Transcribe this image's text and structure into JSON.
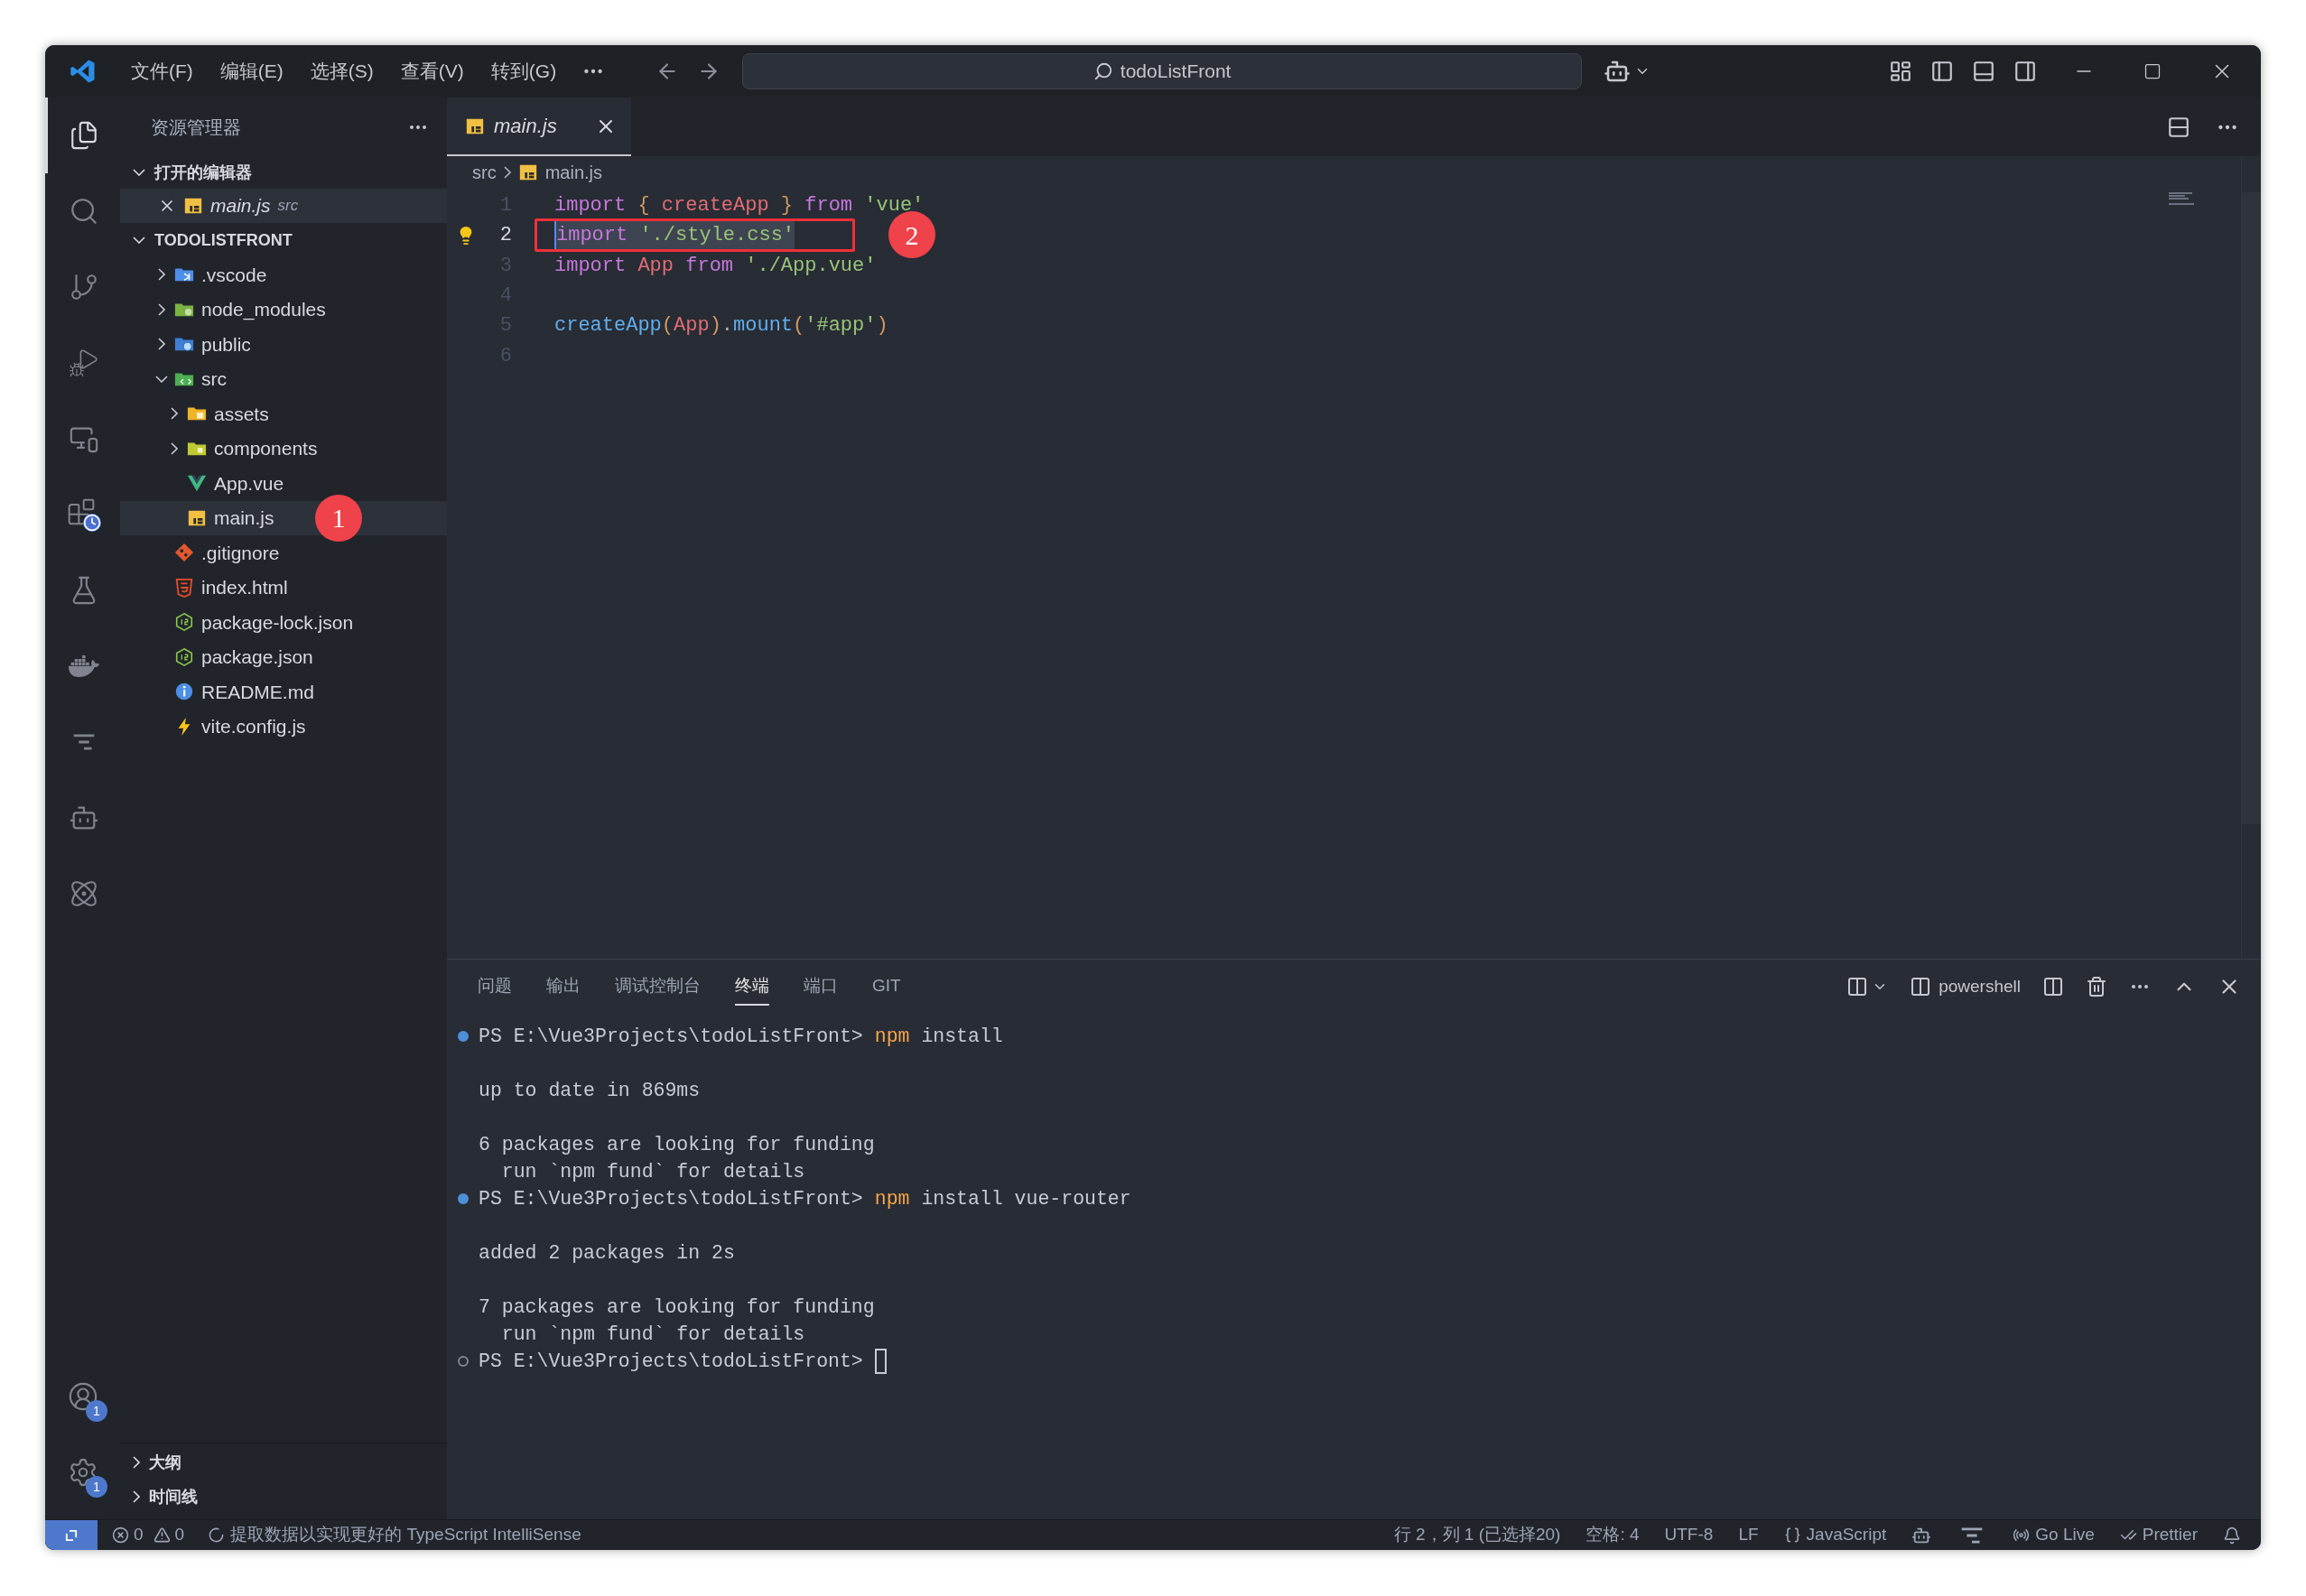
{
  "title_bar": {
    "menu": [
      "文件(F)",
      "编辑(E)",
      "选择(S)",
      "查看(V)",
      "转到(G)"
    ],
    "search": "todoListFront"
  },
  "activity_bar": {
    "items": [
      {
        "kind": "files",
        "selected": true
      },
      {
        "kind": "search",
        "selected": false
      },
      {
        "kind": "scm",
        "selected": false
      },
      {
        "kind": "debug",
        "selected": false
      },
      {
        "kind": "remote",
        "selected": false
      },
      {
        "kind": "extensions",
        "selected": false
      },
      {
        "kind": "testing",
        "selected": false
      },
      {
        "kind": "docker",
        "selected": false
      },
      {
        "kind": "bars",
        "selected": false
      },
      {
        "kind": "copilot",
        "selected": false
      },
      {
        "kind": "kubernetes",
        "selected": false
      }
    ],
    "bottom": [
      {
        "kind": "account",
        "badge": "1"
      },
      {
        "kind": "settings",
        "badge": "1"
      }
    ]
  },
  "sidebar": {
    "title": "资源管理器",
    "open_editors": {
      "label": "打开的编辑器",
      "expanded": true,
      "items": [
        {
          "name": "main.js",
          "detail": "src",
          "kind": "js",
          "selected": true
        }
      ]
    },
    "project": {
      "label": "TODOLISTFRONT",
      "expanded": true,
      "items": [
        {
          "kind": "vscode-folder",
          "name": ".vscode",
          "expanded": false,
          "selected": false
        },
        {
          "kind": "node-folder",
          "name": "node_modules",
          "expanded": false,
          "selected": false
        },
        {
          "kind": "public-folder",
          "name": "public",
          "expanded": false,
          "selected": false
        },
        {
          "kind": "src-folder",
          "name": "src",
          "expanded": true,
          "selected": false,
          "children": [
            {
              "kind": "assets-folder",
              "name": "assets",
              "expanded": false,
              "selected": false
            },
            {
              "kind": "components-folder",
              "name": "components",
              "expanded": false,
              "selected": false
            },
            {
              "kind": "vue",
              "name": "App.vue",
              "selected": false
            },
            {
              "kind": "js",
              "name": "main.js",
              "selected": true,
              "annotation": "1"
            }
          ]
        },
        {
          "kind": "git",
          "name": ".gitignore",
          "selected": false
        },
        {
          "kind": "html",
          "name": "index.html",
          "selected": false
        },
        {
          "kind": "npm",
          "name": "package-lock.json",
          "selected": false
        },
        {
          "kind": "npm",
          "name": "package.json",
          "selected": false
        },
        {
          "kind": "readme",
          "name": "README.md",
          "selected": false
        },
        {
          "kind": "vite",
          "name": "vite.config.js",
          "selected": false
        }
      ]
    },
    "sections": [
      {
        "label": "大纲",
        "expanded": false
      },
      {
        "label": "时间线",
        "expanded": false
      }
    ]
  },
  "editor": {
    "tabs": [
      {
        "label": "main.js",
        "kind": "js",
        "selected": true,
        "preview": true
      }
    ],
    "breadcrumb": [
      {
        "label": "src"
      },
      {
        "label": "main.js",
        "kind": "js"
      }
    ],
    "lines": [
      {
        "number": "1",
        "current": false,
        "tokens": [
          {
            "text": "import ",
            "kind": "keyword"
          },
          {
            "text": "{ ",
            "kind": "brace"
          },
          {
            "text": "createApp ",
            "kind": "variable"
          },
          {
            "text": "} ",
            "kind": "brace"
          },
          {
            "text": "from ",
            "kind": "keyword"
          },
          {
            "text": "'vue'",
            "kind": "string"
          }
        ]
      },
      {
        "number": "2",
        "current": true,
        "selected": true,
        "lightbulb": true,
        "boxed": true,
        "annotation": "2",
        "tokens": [
          {
            "text": "import ",
            "kind": "keyword"
          },
          {
            "text": "'./style.css'",
            "kind": "string"
          }
        ]
      },
      {
        "number": "3",
        "current": false,
        "tokens": [
          {
            "text": "import ",
            "kind": "keyword"
          },
          {
            "text": "App ",
            "kind": "variable"
          },
          {
            "text": "from ",
            "kind": "keyword"
          },
          {
            "text": "'./App.vue'",
            "kind": "string"
          }
        ]
      },
      {
        "number": "4",
        "current": false
      },
      {
        "number": "5",
        "current": false,
        "tokens": [
          {
            "text": "createApp",
            "kind": "function"
          },
          {
            "text": "(",
            "kind": "brace"
          },
          {
            "text": "App",
            "kind": "variable"
          },
          {
            "text": ")",
            "kind": "brace"
          },
          {
            "text": ".",
            "kind": "plain"
          },
          {
            "text": "mount",
            "kind": "function"
          },
          {
            "text": "(",
            "kind": "brace"
          },
          {
            "text": "'#app'",
            "kind": "string"
          },
          {
            "text": ")",
            "kind": "brace"
          }
        ]
      },
      {
        "number": "6",
        "current": false
      }
    ]
  },
  "panel": {
    "tabs": [
      {
        "label": "问题",
        "selected": false
      },
      {
        "label": "输出",
        "selected": false
      },
      {
        "label": "调试控制台",
        "selected": false
      },
      {
        "label": "终端",
        "selected": true
      },
      {
        "label": "端口",
        "selected": false
      },
      {
        "label": "GIT",
        "selected": false
      }
    ],
    "terminal_name": "powershell",
    "lines": [
      {
        "kind": "prompt",
        "finished": true,
        "prompt": "PS E:\\Vue3Projects\\todoListFront>",
        "program": "npm",
        "args": "install"
      },
      {
        "kind": "blank"
      },
      {
        "kind": "output",
        "text": "up to date in 869ms"
      },
      {
        "kind": "blank"
      },
      {
        "kind": "output",
        "text": "6 packages are looking for funding"
      },
      {
        "kind": "output",
        "text": "  run `npm fund` for details"
      },
      {
        "kind": "prompt",
        "finished": true,
        "prompt": "PS E:\\Vue3Projects\\todoListFront>",
        "program": "npm",
        "args": "install vue-router"
      },
      {
        "kind": "blank"
      },
      {
        "kind": "output",
        "text": "added 2 packages in 2s"
      },
      {
        "kind": "blank"
      },
      {
        "kind": "output",
        "text": "7 packages are looking for funding"
      },
      {
        "kind": "output",
        "text": "  run `npm fund` for details"
      },
      {
        "kind": "prompt",
        "finished": false,
        "prompt": "PS E:\\Vue3Projects\\todoListFront>",
        "cursor": true
      }
    ]
  },
  "status_bar": {
    "left": [
      {
        "kind": "remote"
      },
      {
        "kind": "problems",
        "errors": "0",
        "warnings": "0"
      },
      {
        "kind": "progress",
        "text": "提取数据以实现更好的 TypeScript IntelliSense"
      }
    ],
    "right": [
      {
        "kind": "text",
        "text": "行 2，列 1 (已选择20)"
      },
      {
        "kind": "text",
        "text": "空格: 4"
      },
      {
        "kind": "text",
        "text": "UTF-8"
      },
      {
        "kind": "text",
        "text": "LF"
      },
      {
        "kind": "language",
        "text": "JavaScript"
      },
      {
        "kind": "copilot"
      },
      {
        "kind": "ports"
      },
      {
        "kind": "golive",
        "text": "Go Live"
      },
      {
        "kind": "prettier",
        "text": "Prettier"
      },
      {
        "kind": "bell"
      }
    ]
  }
}
